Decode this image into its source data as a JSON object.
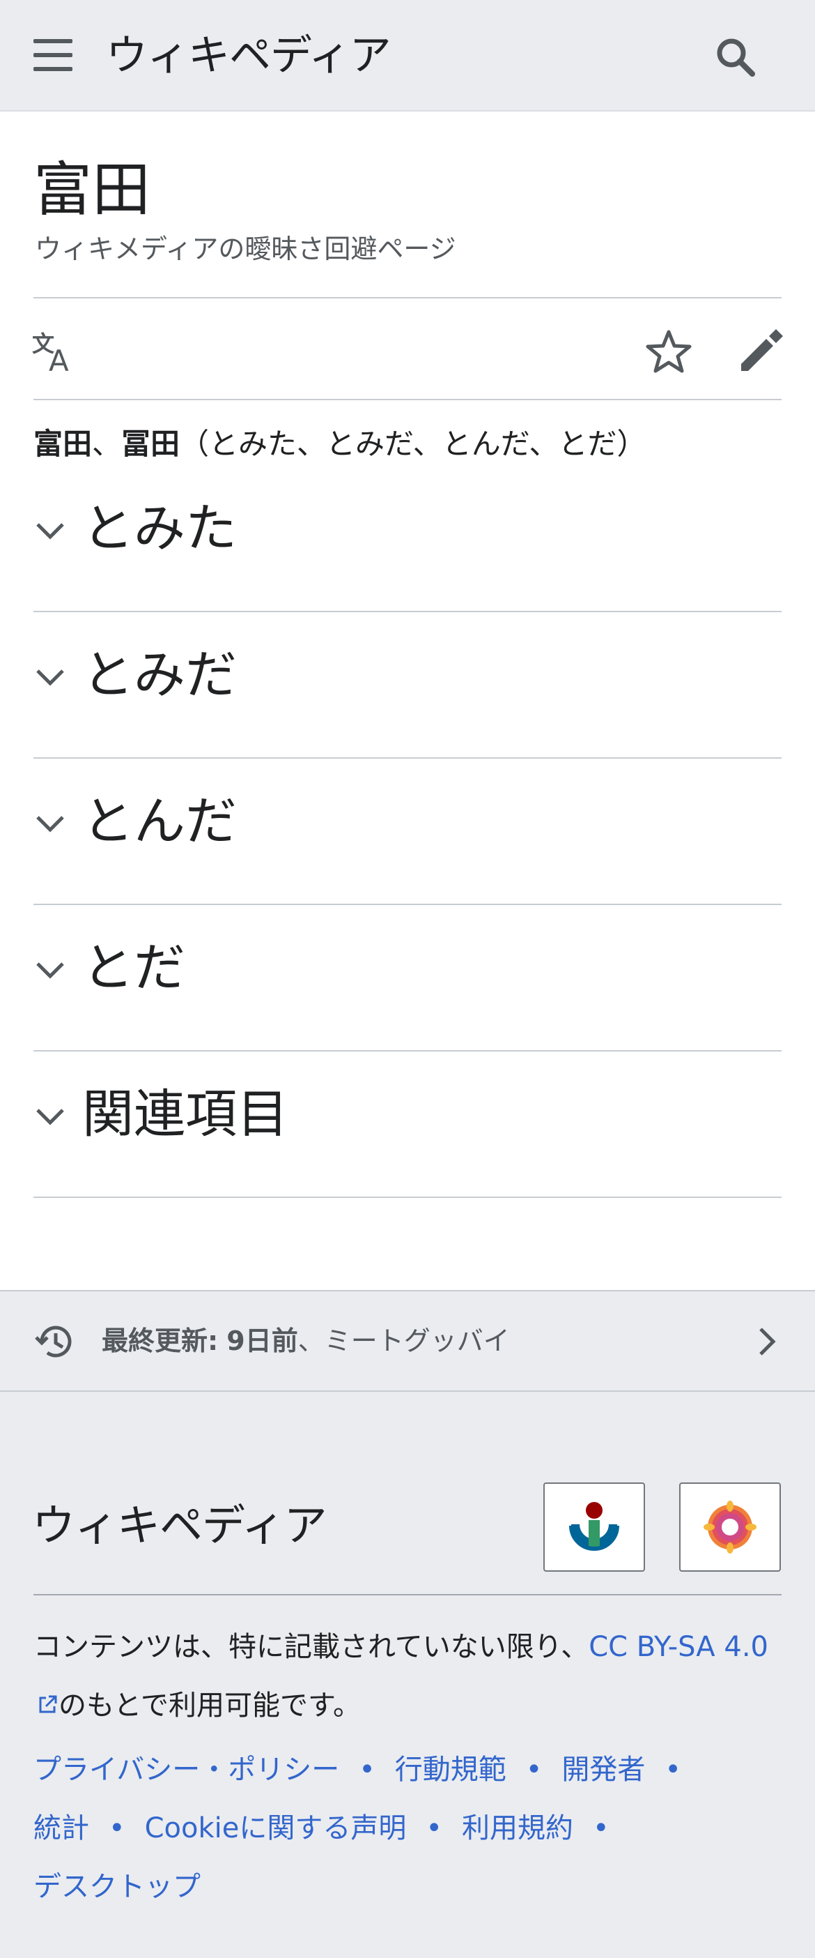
{
  "header": {
    "wordmark": "ウィキペディア",
    "menu_icon": "hamburger-menu-icon",
    "search_icon": "search-icon"
  },
  "page": {
    "title": "富田",
    "subtitle": "ウィキメディアの曖昧さ回避ページ"
  },
  "toolbar": {
    "language_icon": "language-icon",
    "watch_icon": "star-icon",
    "edit_icon": "pencil-icon"
  },
  "lead": {
    "term1": "富田",
    "sep": "、",
    "term2": "冨田",
    "readings": "（とみた、とみだ、とんだ、とだ）"
  },
  "sections": [
    {
      "label": "とみた"
    },
    {
      "label": "とみだ"
    },
    {
      "label": "とんだ"
    },
    {
      "label": "とだ"
    },
    {
      "label": "関連項目"
    }
  ],
  "last_updated": {
    "label": "最終更新:",
    "time": "9日前",
    "editor": "、ミートグッバイ"
  },
  "footer": {
    "wordmark": "ウィキペディア",
    "badge_1": "wikimedia-foundation-logo",
    "badge_2": "mediawiki-logo",
    "license_prefix": "コンテンツは、特に記載されていない限り、",
    "license_link": "CC BY-SA 4.0",
    "license_suffix": "のもとで利用可能です。",
    "links": [
      "プライバシー・ポリシー",
      "行動規範",
      "開発者",
      "統計",
      "Cookieに関する声明",
      "利用規約",
      "デスクトップ"
    ],
    "separator": "•"
  },
  "colors": {
    "link": "#3366cc",
    "chrome_bg": "#eaecf0",
    "text": "#202122",
    "icon": "#54595d"
  }
}
